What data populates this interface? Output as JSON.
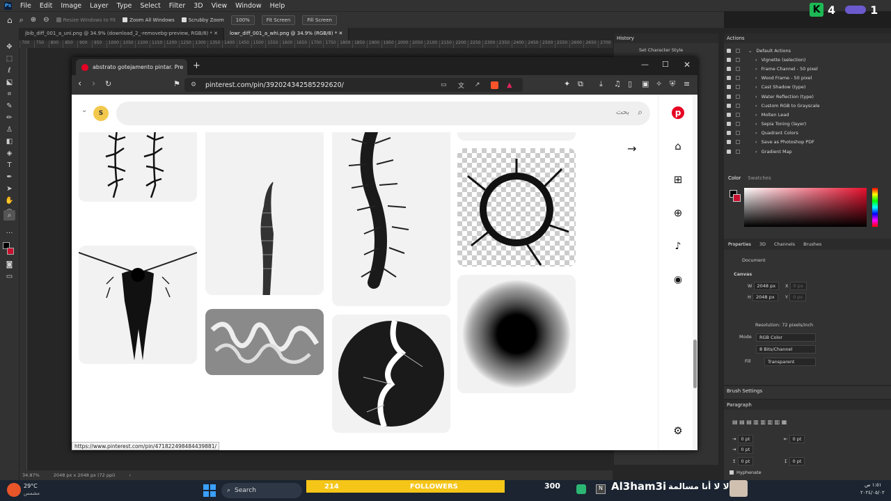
{
  "ps": {
    "menu": [
      "File",
      "Edit",
      "Image",
      "Layer",
      "Type",
      "Select",
      "Filter",
      "3D",
      "View",
      "Window",
      "Help"
    ],
    "options": {
      "resize": "Resize Windows to Fit",
      "zoom_all": "Zoom All Windows",
      "scrubby": "Scrubby Zoom",
      "pct": "100%",
      "fit": "Fit Screen",
      "fill": "Fill Screen"
    },
    "tabs": [
      "jbib_diff_001_a_uni.png @ 34.9% (download_2_-removebg-preview, RGB/8) *",
      "lowr_diff_001_a_whi.png @ 34.9% (RGB/8) *"
    ],
    "ruler": [
      "700",
      "750",
      "800",
      "850",
      "900",
      "950",
      "1000",
      "1050",
      "1100",
      "1150",
      "1200",
      "1250",
      "1300",
      "1350",
      "1400",
      "1450",
      "1500",
      "1550",
      "1600",
      "1650",
      "1700",
      "1750",
      "1800",
      "1850",
      "1900",
      "1950",
      "2000",
      "2050",
      "2100",
      "2150",
      "2200",
      "2250",
      "2300",
      "2350",
      "2400",
      "2450",
      "2500",
      "2550",
      "2600",
      "2650",
      "2700"
    ],
    "status": {
      "zoom": "34.87%",
      "size": "2048 px x 2048 px (72 ppi)"
    },
    "history": {
      "title": "History",
      "item": "Set Character Style"
    },
    "actions": {
      "title": "Actions",
      "items": [
        "Default Actions",
        "Vignette (selection)",
        "Frame Channel - 50 pixel",
        "Wood Frame - 50 pixel",
        "Cast Shadow (type)",
        "Water Reflection (type)",
        "Custom RGB to Grayscale",
        "Molten Lead",
        "Sepia Toning (layer)",
        "Quadrant Colors",
        "Save as Photoshop PDF",
        "Gradient Map"
      ]
    },
    "color_tabs": [
      "Color",
      "Swatches"
    ],
    "props_tabs": [
      "Properties",
      "3D",
      "Channels",
      "Brushes"
    ],
    "props": {
      "document": "Document",
      "canvas": "Canvas",
      "w": "2048 px",
      "h": "2048 px",
      "x_lbl": "X",
      "y_lbl": "Y",
      "x": "0 px",
      "y": "0 px",
      "resolution": "Resolution: 72 pixels/inch",
      "mode_lbl": "Mode",
      "mode": "RGB Color",
      "depth": "8 Bits/Channel",
      "fill_lbl": "Fill",
      "fill": "Transparent"
    },
    "brush": "Brush Settings",
    "para": {
      "title": "Paragraph",
      "v": [
        "0 pt",
        "0 pt",
        "0 pt",
        "0 pt",
        "0 pt"
      ],
      "hyphenate": "Hyphenate"
    },
    "k_count": "4",
    "k_right": "1"
  },
  "browser": {
    "tab_title": "abstrato gotejamento pintar. Pre",
    "url": "pinterest.com/pin/392024342585292620/",
    "search_placeholder": "بحث",
    "avatar": "S",
    "link": "https://www.pinterest.com/pin/471822498484439881/"
  },
  "taskbar": {
    "temp": "29°C",
    "weather": "مشمس",
    "search": "Search",
    "followers_num": "214",
    "followers": "FOLLOWERS",
    "views": "300",
    "stream": "Al3ham3i",
    "arabic": "لا لا أنا مسالمة",
    "time": "١:٥١ ص",
    "date": "٢٠٢٤/٠٥/٠٢"
  }
}
